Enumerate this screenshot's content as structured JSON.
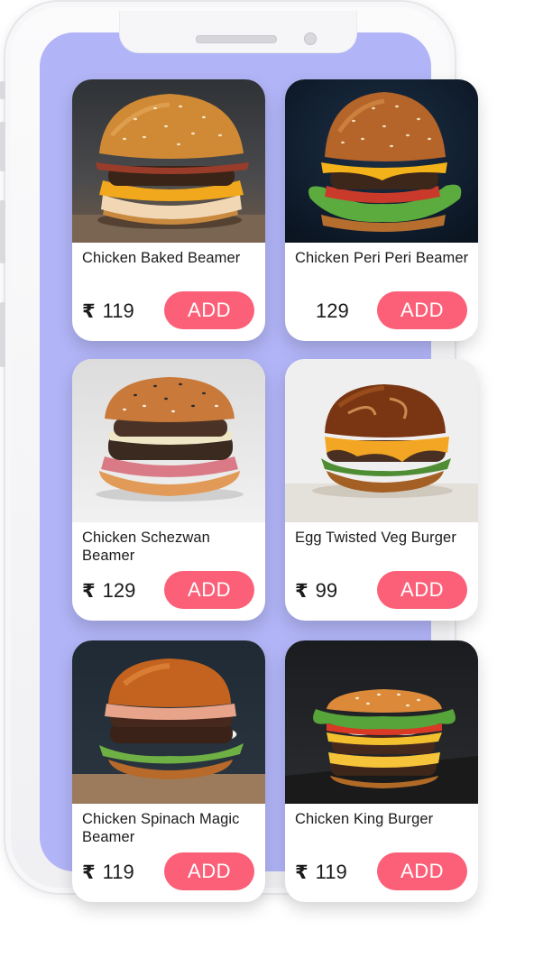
{
  "app": {
    "accent_color": "#fc6078",
    "screen_color": "#b1b4f6",
    "currency_symbol": "₹"
  },
  "menu": {
    "items": [
      {
        "name": "Chicken Baked Beamer",
        "price": "119",
        "show_currency": true,
        "button_label": "ADD",
        "image": "burger-photo"
      },
      {
        "name": "Chicken Peri Peri Beamer",
        "price": "129",
        "show_currency": false,
        "button_label": "ADD",
        "image": "burger-photo"
      },
      {
        "name": "Chicken Schezwan Beamer",
        "price": "129",
        "show_currency": true,
        "button_label": "ADD",
        "image": "burger-photo"
      },
      {
        "name": "Egg Twisted Veg Burger",
        "price": "99",
        "show_currency": true,
        "button_label": "ADD",
        "image": "burger-photo"
      },
      {
        "name": "Chicken Spinach Magic Beamer",
        "price": "119",
        "show_currency": true,
        "button_label": "ADD",
        "image": "burger-photo"
      },
      {
        "name": "Chicken King Burger",
        "price": "119",
        "show_currency": true,
        "button_label": "ADD",
        "image": "burger-photo"
      }
    ]
  }
}
